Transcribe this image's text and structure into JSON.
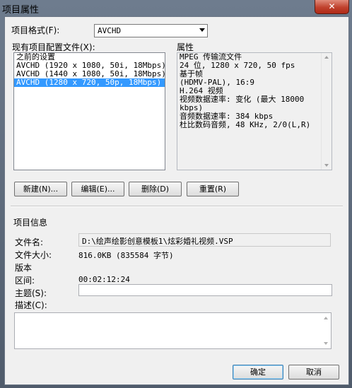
{
  "window": {
    "title": "项目属性",
    "close_label": "✕"
  },
  "format": {
    "label": "项目格式(F):",
    "selected": "AVCHD"
  },
  "profiles": {
    "label": "现有项目配置文件(X):",
    "items": [
      {
        "label": "之前的设置",
        "selected": false
      },
      {
        "label": "AVCHD (1920 x 1080, 50i, 18Mbps)",
        "selected": false
      },
      {
        "label": "AVCHD (1440 x 1080, 50i, 18Mbps)",
        "selected": false
      },
      {
        "label": "AVCHD (1280 x 720, 50p, 18Mbps)",
        "selected": true
      }
    ]
  },
  "properties": {
    "label": "属性",
    "lines": [
      "MPEG 传输流文件",
      "24 位, 1280 x 720, 50 fps",
      "基于帧",
      "(HDMV-PAL),  16:9",
      "H.264 视频",
      "视频数据速率: 变化 (最大 18000",
      "kbps)",
      "音频数据速率: 384 kbps",
      "杜比数码音频, 48 KHz, 2/0(L,R)"
    ]
  },
  "buttons": {
    "new": "新建(N)...",
    "edit": "编辑(E)...",
    "delete": "删除(D)",
    "reset": "重置(R)",
    "ok": "确定",
    "cancel": "取消"
  },
  "info": {
    "heading": "项目信息",
    "filename_label": "文件名:",
    "filename_value": "D:\\绘声绘影创意模板1\\炫彩婚礼视频.VSP",
    "filesize_label": "文件大小:",
    "filesize_value": "816.0KB (835584 字节)",
    "version_label": "版本",
    "version_value": "",
    "duration_label": "区间:",
    "duration_value": "00:02:12:24",
    "subject_label": "主题(S):",
    "subject_value": "",
    "description_label": "描述(C):",
    "description_value": ""
  }
}
